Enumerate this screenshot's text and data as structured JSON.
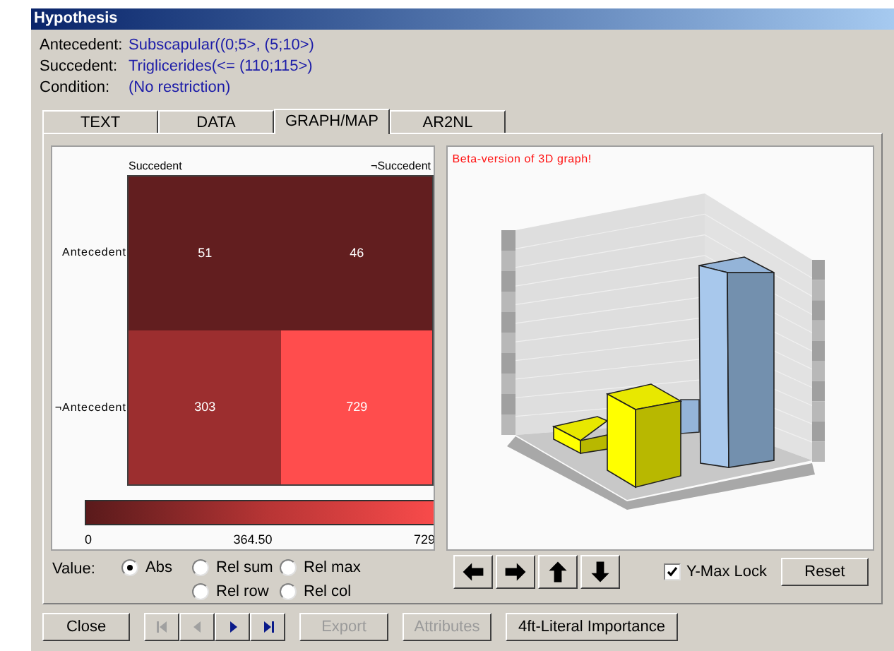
{
  "window": {
    "title": "Hypothesis"
  },
  "fields": [
    {
      "label": "Antecedent:",
      "value": "Subscapular((0;5>, (5;10>)"
    },
    {
      "label": "Succedent:",
      "value": "Triglicerides(<= (110;115>)"
    },
    {
      "label": "Condition:",
      "value": "(No restriction)"
    }
  ],
  "tabs": [
    {
      "label": "TEXT",
      "selected": false
    },
    {
      "label": "DATA",
      "selected": false
    },
    {
      "label": "GRAPH/MAP",
      "selected": true
    },
    {
      "label": "AR2NL",
      "selected": false
    }
  ],
  "heatmap": {
    "column_labels": [
      "Succedent",
      "¬Succedent"
    ],
    "rows": [
      {
        "label": "Antecedent",
        "cells": [
          {
            "value": "51",
            "color": "#621e1f"
          },
          {
            "value": "46",
            "color": "#621e1f"
          }
        ]
      },
      {
        "label": "¬Antecedent",
        "cells": [
          {
            "value": "303",
            "color": "#9c2e2f"
          },
          {
            "value": "729",
            "color": "#ff4d4d"
          }
        ]
      }
    ],
    "scale": {
      "ticks": [
        "0",
        "364.50",
        "729"
      ]
    }
  },
  "graph": {
    "note": "Beta-version of 3D graph!"
  },
  "value_options": {
    "label": "Value:",
    "options": [
      {
        "label": "Abs",
        "selected": true
      },
      {
        "label": "Rel sum",
        "selected": false
      },
      {
        "label": "Rel max",
        "selected": false
      },
      {
        "label": "Rel row",
        "selected": false
      },
      {
        "label": "Rel col",
        "selected": false
      }
    ]
  },
  "y_max_lock": {
    "label": "Y-Max Lock",
    "checked": true
  },
  "reset_button": "Reset",
  "close_button": "Close",
  "record_navigation": [
    {
      "kind": "first",
      "disabled": true
    },
    {
      "kind": "previous",
      "disabled": true
    },
    {
      "kind": "next",
      "disabled": false
    },
    {
      "kind": "last",
      "disabled": false
    }
  ],
  "action_buttons": [
    {
      "label": "Export",
      "disabled": true
    },
    {
      "label": "Attributes",
      "disabled": true
    },
    {
      "label": "4ft-Literal Importance",
      "disabled": false
    }
  ]
}
